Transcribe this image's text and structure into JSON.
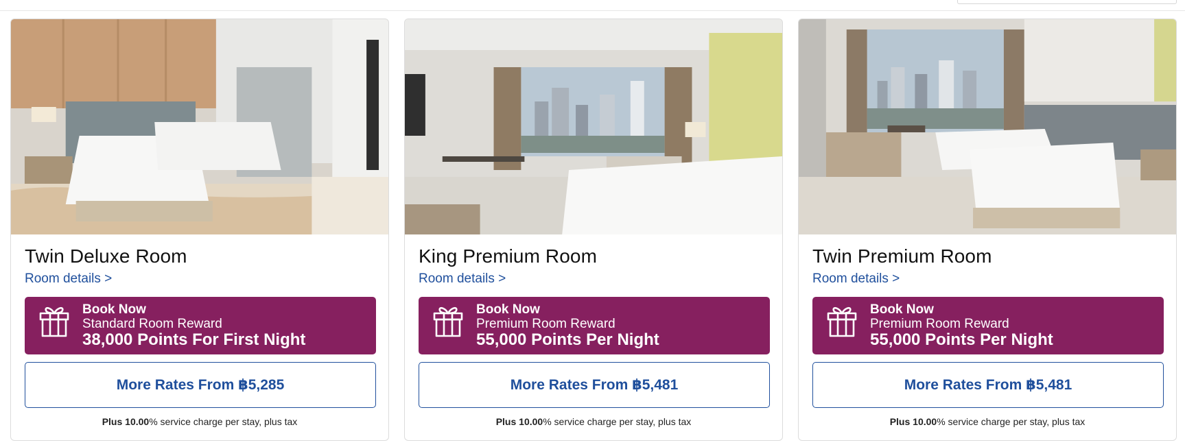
{
  "rooms": [
    {
      "title": "Twin Deluxe Room",
      "details_link": "Room details >",
      "reward": {
        "line1": "Book Now",
        "line2": "Standard Room Reward",
        "line3": "38,000 Points For First Night",
        "icon": "gift-icon"
      },
      "rates_button": "More Rates From ฿5,285",
      "note": {
        "prefix": "Plus",
        "percent": "10.00",
        "suffix": "% service charge per stay, plus tax"
      },
      "photo": "twin-beds-room-photo"
    },
    {
      "title": "King Premium Room",
      "details_link": "Room details >",
      "reward": {
        "line1": "Book Now",
        "line2": "Premium Room Reward",
        "line3": "55,000 Points Per Night",
        "icon": "gift-icon"
      },
      "rates_button": "More Rates From ฿5,481",
      "note": {
        "prefix": "Plus",
        "percent": "10.00",
        "suffix": "% service charge per stay, plus tax"
      },
      "photo": "king-bed-room-city-view-photo"
    },
    {
      "title": "Twin Premium Room",
      "details_link": "Room details >",
      "reward": {
        "line1": "Book Now",
        "line2": "Premium Room Reward",
        "line3": "55,000 Points Per Night",
        "icon": "gift-icon"
      },
      "rates_button": "More Rates From ฿5,481",
      "note": {
        "prefix": "Plus",
        "percent": "10.00",
        "suffix": "% service charge per stay, plus tax"
      },
      "photo": "twin-beds-room-river-view-photo"
    }
  ],
  "colors": {
    "reward_bg": "#86205f",
    "link": "#1f4f9c",
    "border": "#dcdcdc"
  }
}
